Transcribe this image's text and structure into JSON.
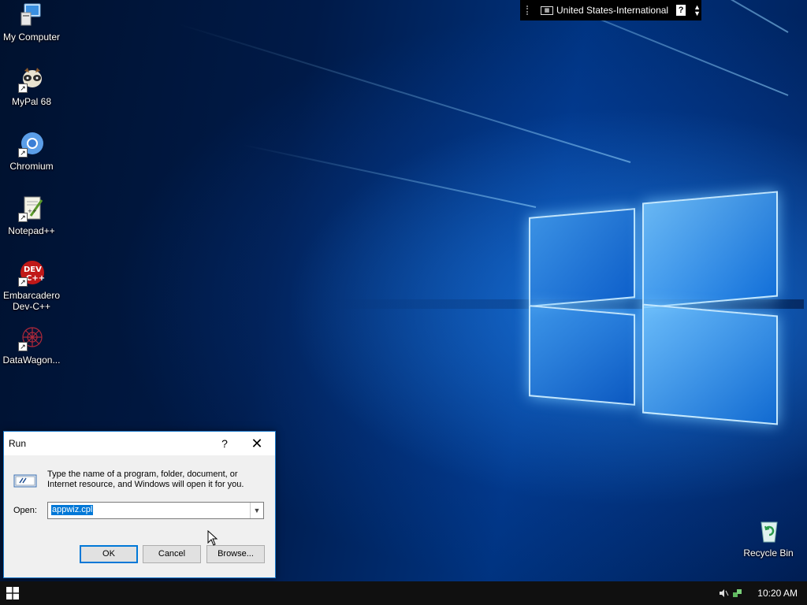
{
  "desktop": {
    "icons": [
      {
        "label": "My Computer",
        "icon": "computer-icon"
      },
      {
        "label": "MyPal 68",
        "icon": "mypal-icon"
      },
      {
        "label": "Chromium",
        "icon": "chromium-icon"
      },
      {
        "label": "Notepad++",
        "icon": "notepad-plus-plus-icon"
      },
      {
        "label": "Embarcadero Dev-C++",
        "icon": "dev-cpp-icon"
      },
      {
        "label": "DataWagon...",
        "icon": "datawagon-icon"
      }
    ],
    "recycle_bin": {
      "label": "Recycle Bin",
      "icon": "recycle-bin-icon"
    }
  },
  "language_bar": {
    "language": "United States-International",
    "help": "?"
  },
  "run_dialog": {
    "title": "Run",
    "help_button": "?",
    "close_button": "✕",
    "description": "Type the name of a program, folder, document, or Internet resource, and Windows will open it for you.",
    "open_label": "Open:",
    "open_value": "appwiz.cpl",
    "ok_label": "OK",
    "cancel_label": "Cancel",
    "browse_label": "Browse..."
  },
  "taskbar": {
    "clock": "10:20 AM"
  },
  "colors": {
    "accent": "#0078d7",
    "taskbar": "#101010",
    "wallpaper_dark": "#001a48",
    "wallpaper_light": "#6ec6ff"
  }
}
